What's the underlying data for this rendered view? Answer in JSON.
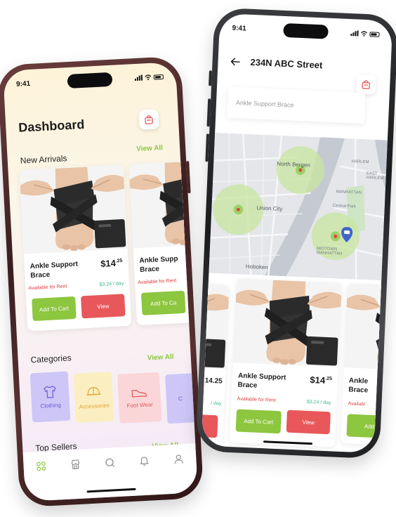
{
  "left_phone": {
    "status_time": "9:41",
    "title": "Dashboard",
    "new_arrivals": {
      "title": "New Arrivals",
      "view_all": "View All",
      "products": [
        {
          "name_line1": "Ankle Support",
          "name_line2": "Brace",
          "price_main": "$14",
          "price_cents": ".25",
          "availability": "Available for Rent",
          "rate": "$3.24 / day",
          "add_label": "Add To Cart",
          "view_label": "View"
        },
        {
          "name_line1": "Ankle Supp",
          "name_line2": "Brace",
          "availability": "Available for Rent",
          "add_label": "Add To Ca"
        }
      ]
    },
    "categories": {
      "title": "Categories",
      "view_all": "View All",
      "items": [
        {
          "label": "Clothing",
          "icon": "shirt-icon",
          "bg": "#cdc6f7",
          "color": "#6b5bd6"
        },
        {
          "label": "Accessories",
          "icon": "helmet-icon",
          "bg": "#fbeec0",
          "color": "#e0a53a"
        },
        {
          "label": "Foot Wear",
          "icon": "shoe-icon",
          "bg": "#fbd6d8",
          "color": "#e2575a"
        },
        {
          "label": "C",
          "icon": "category-icon",
          "bg": "#cdc6f7",
          "color": "#6b5bd6"
        }
      ]
    },
    "top_sellers": {
      "title": "Top Sellers",
      "view_all": "View All"
    },
    "tabbar": [
      "grid-icon",
      "store-icon",
      "search-icon",
      "bell-icon",
      "profile-icon"
    ]
  },
  "right_phone": {
    "status_time": "9:41",
    "address": "234N ABC Street",
    "search_value": "Ankle Support Brace",
    "map": {
      "labels": {
        "north_bergen": "North Bergen",
        "harlem": "HARLEM",
        "east_harlem": "EAST\nHARLEM",
        "manhattan": "MANHATTAN",
        "union_city": "Union City",
        "central_park": "Central Park",
        "midtown": "MIDTOWN\nMANHATTAN",
        "hoboken": "Hoboken"
      }
    },
    "products": [
      {
        "price_fragment": "14.25",
        "rate_fragment": "/ day"
      },
      {
        "name_line1": "Ankle Support",
        "name_line2": "Brace",
        "price_main": "$14",
        "price_cents": ".25",
        "availability": "Available for Rent",
        "rate": "$3.24 / day",
        "add_label": "Add To Cart",
        "view_label": "View"
      },
      {
        "name_line1": "Ankle",
        "name_line2": "Brace",
        "availability": "Availabl",
        "add_label": "Add"
      }
    ],
    "colors": {
      "accent_green": "#8dc63f",
      "accent_red": "#e8585a",
      "rent_red": "#e23a3a",
      "rate_teal": "#3bb88a",
      "map_circle": "#c8e6a0"
    }
  }
}
